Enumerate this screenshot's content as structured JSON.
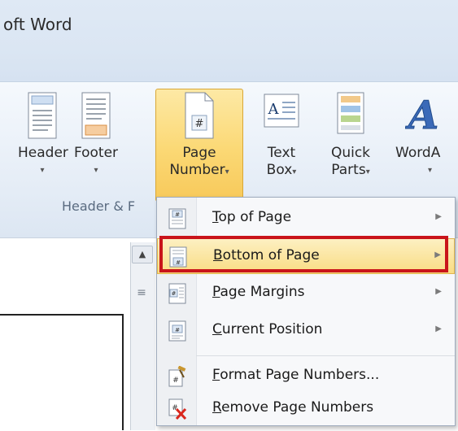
{
  "window": {
    "title": "oft Word"
  },
  "ribbon": {
    "group_label": "Header & F",
    "buttons": {
      "header": {
        "line1": "Header",
        "arrow": "▾"
      },
      "footer": {
        "line1": "Footer",
        "arrow": "▾"
      },
      "page_number": {
        "line1": "Page",
        "line2": "Number",
        "arrow": "▾"
      },
      "text_box": {
        "line1": "Text",
        "line2": "Box",
        "arrow": "▾"
      },
      "quick_parts": {
        "line1": "Quick",
        "line2": "Parts",
        "arrow": "▾"
      },
      "wordart": {
        "line1": "WordA",
        "arrow": "▾"
      }
    }
  },
  "menu": {
    "items": [
      {
        "key": "T",
        "rest": "op of Page",
        "submenu": true
      },
      {
        "key": "B",
        "rest": "ottom of Page",
        "submenu": true,
        "highlighted": true
      },
      {
        "key": "P",
        "rest": "age Margins",
        "submenu": true
      },
      {
        "key": "C",
        "rest": "urrent Position",
        "submenu": true
      },
      {
        "key": "F",
        "rest": "ormat Page Numbers...",
        "submenu": false
      },
      {
        "key": "R",
        "rest": "emove Page Numbers",
        "submenu": false
      }
    ],
    "submenu_glyph": "▶"
  },
  "scrollbar": {
    "up_glyph": "▲",
    "thumb_glyph": "≡"
  },
  "colors": {
    "highlight_box": "#c9141a",
    "hover_fill": "#f9dc83",
    "accent": "#fbd874"
  }
}
